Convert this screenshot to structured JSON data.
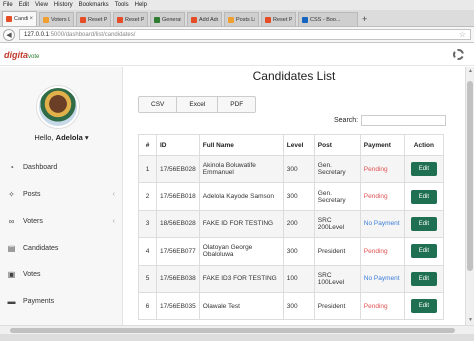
{
  "browser": {
    "menu": [
      "File",
      "Edit",
      "View",
      "History",
      "Bookmarks",
      "Tools",
      "Help"
    ],
    "tabs": [
      {
        "label": "Candi...",
        "color": "#e44d26",
        "active": true
      },
      {
        "label": "Voters Lis...",
        "color": "#f0a030"
      },
      {
        "label": "Reset Pas...",
        "color": "#e44d26"
      },
      {
        "label": "Reset Pas...",
        "color": "#e44d26"
      },
      {
        "label": "Generate ...",
        "color": "#2e7d32"
      },
      {
        "label": "Add Adm...",
        "color": "#e44d26"
      },
      {
        "label": "Posts List...",
        "color": "#f0a030"
      },
      {
        "label": "Reset Pas...",
        "color": "#e44d26"
      },
      {
        "label": "CSS - Boo...",
        "color": "#1565c0"
      }
    ],
    "url_host": "127.0.0.1",
    "url_path": ":5000/dashboard/list/candidates/"
  },
  "app": {
    "logo_main": "digita",
    "logo_sub": "vote"
  },
  "sidebar": {
    "hello_prefix": "Hello,",
    "user": "Adelola",
    "items": [
      {
        "label": "Dashboard",
        "icon": "gauge-icon",
        "chevron": false
      },
      {
        "label": "Posts",
        "icon": "pin-icon",
        "chevron": true
      },
      {
        "label": "Voters",
        "icon": "users-icon",
        "chevron": true
      },
      {
        "label": "Candidates",
        "icon": "list-icon",
        "chevron": false
      },
      {
        "label": "Votes",
        "icon": "ballot-icon",
        "chevron": false
      },
      {
        "label": "Payments",
        "icon": "card-icon",
        "chevron": false
      }
    ]
  },
  "main": {
    "title": "Candidates List",
    "exports": [
      "CSV",
      "Excel",
      "PDF"
    ],
    "search_label": "Search:",
    "columns": [
      "#",
      "ID",
      "Full Name",
      "Level",
      "Post",
      "Payment",
      "Action"
    ],
    "rows": [
      {
        "n": "1",
        "id": "17/56EB028",
        "name": "Akinola Boluwatife Emmanuel",
        "level": "300",
        "post": "Gen. Secretary",
        "payment": "Pending",
        "action": "Edit"
      },
      {
        "n": "2",
        "id": "17/56EB018",
        "name": "Adelola Kayode Samson",
        "level": "300",
        "post": "Gen. Secretary",
        "payment": "Pending",
        "action": "Edit"
      },
      {
        "n": "3",
        "id": "18/56EB028",
        "name": "FAKE ID FOR TESTING",
        "level": "200",
        "post": "SRC 200Level",
        "payment": "No Payment",
        "action": "Edit"
      },
      {
        "n": "4",
        "id": "17/56EB077",
        "name": "Olatoyan George Obaloluwa",
        "level": "300",
        "post": "President",
        "payment": "Pending",
        "action": "Edit"
      },
      {
        "n": "5",
        "id": "17/56EB038",
        "name": "FAKE ID3 FOR TESTING",
        "level": "100",
        "post": "SRC 100Level",
        "payment": "No Payment",
        "action": "Edit"
      },
      {
        "n": "6",
        "id": "17/56EB035",
        "name": "Olawale Test",
        "level": "300",
        "post": "President",
        "payment": "Pending",
        "action": "Edit"
      }
    ]
  }
}
